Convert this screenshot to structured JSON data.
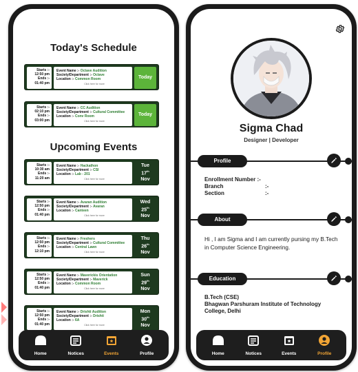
{
  "left_screen": {
    "today_title": "Today's Schedule",
    "upcoming_title": "Upcoming Events",
    "today_events": [
      {
        "starts_label": "Starts :-",
        "start": "12:50 pm",
        "ends_label": "Ends :-",
        "end": "01:40 pm",
        "name_label": "Event Name :-",
        "name": "Octave Audition",
        "society_label": "Society/Department :-",
        "society": "Octave",
        "location_label": "Location :-",
        "location": "Common Room",
        "more": "Click here for more",
        "badge": "Today"
      },
      {
        "starts_label": "Starts :-",
        "start": "02:10 pm",
        "ends_label": "Ends :-",
        "end": "03:00 pm",
        "name_label": "Event Name :-",
        "name": "CC Audition",
        "society_label": "Society/Department :-",
        "society": "Cultural Committee",
        "location_label": "Location :-",
        "location": "Conv Room",
        "more": "Click here for more",
        "badge": "Today"
      }
    ],
    "upcoming_events": [
      {
        "starts_label": "Starts :-",
        "start": "10:30 am",
        "ends_label": "Ends :-",
        "end": "11:20 am",
        "name_label": "Event Name :-",
        "name": "Hackathon",
        "society_label": "Society/Department :-",
        "society": "CSI",
        "location_label": "Location :-",
        "location": "Lab - 201",
        "more": "Click here for more",
        "day": "Tue",
        "date": "17",
        "sup": "th",
        "month": "Nov"
      },
      {
        "starts_label": "Starts :-",
        "start": "12:50 pm",
        "ends_label": "Ends :-",
        "end": "01:40 pm",
        "name_label": "Event Name :-",
        "name": "Avaran Audition",
        "society_label": "Society/Department :-",
        "society": "Avaran",
        "location_label": "Location :-",
        "location": "Canteen",
        "more": "Click here for more",
        "day": "Wed",
        "date": "25",
        "sup": "th",
        "month": "Nov"
      },
      {
        "starts_label": "Starts :-",
        "start": "12:50 pm",
        "ends_label": "Ends :-",
        "end": "12:10 pm",
        "name_label": "Event Name :-",
        "name": "Freshers",
        "society_label": "Society/Department :-",
        "society": "Cultural Committee",
        "location_label": "Location :-",
        "location": "Central Lawn",
        "more": "Click here for more",
        "day": "Thu",
        "date": "26",
        "sup": "th",
        "month": "Nov"
      },
      {
        "starts_label": "Starts :-",
        "start": "12:50 pm",
        "ends_label": "Ends :-",
        "end": "01:40 pm",
        "name_label": "Event Name :-",
        "name": "Maverickis Orientation",
        "society_label": "Society/Department :-",
        "society": "Maverick",
        "location_label": "Location :-",
        "location": "Common Room",
        "more": "Click here for more",
        "day": "Sun",
        "date": "29",
        "sup": "th",
        "month": "Nov"
      },
      {
        "starts_label": "Starts :-",
        "start": "12:50 pm",
        "ends_label": "Ends :-",
        "end": "01:40 pm",
        "name_label": "Event Name :-",
        "name": "Drishti Audition",
        "society_label": "Society/Department :-",
        "society": "Drishti",
        "location_label": "Location :-",
        "location": "6A",
        "more": "Click here for more",
        "day": "Mon",
        "date": "30",
        "sup": "th",
        "month": "Nov"
      }
    ],
    "nav": [
      {
        "label": "Home",
        "icon": "home-icon"
      },
      {
        "label": "Notices",
        "icon": "notices-icon"
      },
      {
        "label": "Events",
        "icon": "events-icon"
      },
      {
        "label": "Profile",
        "icon": "profile-icon"
      }
    ],
    "active_nav": "Events"
  },
  "right_screen": {
    "name": "Sigma Chad",
    "role": "Designer | Developer",
    "profile_section": "Profile",
    "enrollment_label": "Enrollment Number :-",
    "branch_label": "Branch",
    "branch_sep": ":-",
    "section_label": "Section",
    "section_sep": ":-",
    "about_section": "About",
    "about_text": "Hi , I am Sigma and I am currently pursing my B.Tech in Computer Science Engineering.",
    "education_section": "Education",
    "degree": "B.Tech (CSE)",
    "college": "Bhagwan Parshuram Institute of Technology College, Delhi",
    "nav": [
      {
        "label": "Home",
        "icon": "home-icon"
      },
      {
        "label": "Notices",
        "icon": "notices-icon"
      },
      {
        "label": "Events",
        "icon": "events-icon"
      },
      {
        "label": "Profile",
        "icon": "profile-icon"
      }
    ],
    "active_nav": "Profile"
  },
  "colors": {
    "card_bg": "#1e3a1f",
    "today_badge": "#5cb43a",
    "accent": "#f2a535",
    "dark": "#1b1b1b"
  }
}
